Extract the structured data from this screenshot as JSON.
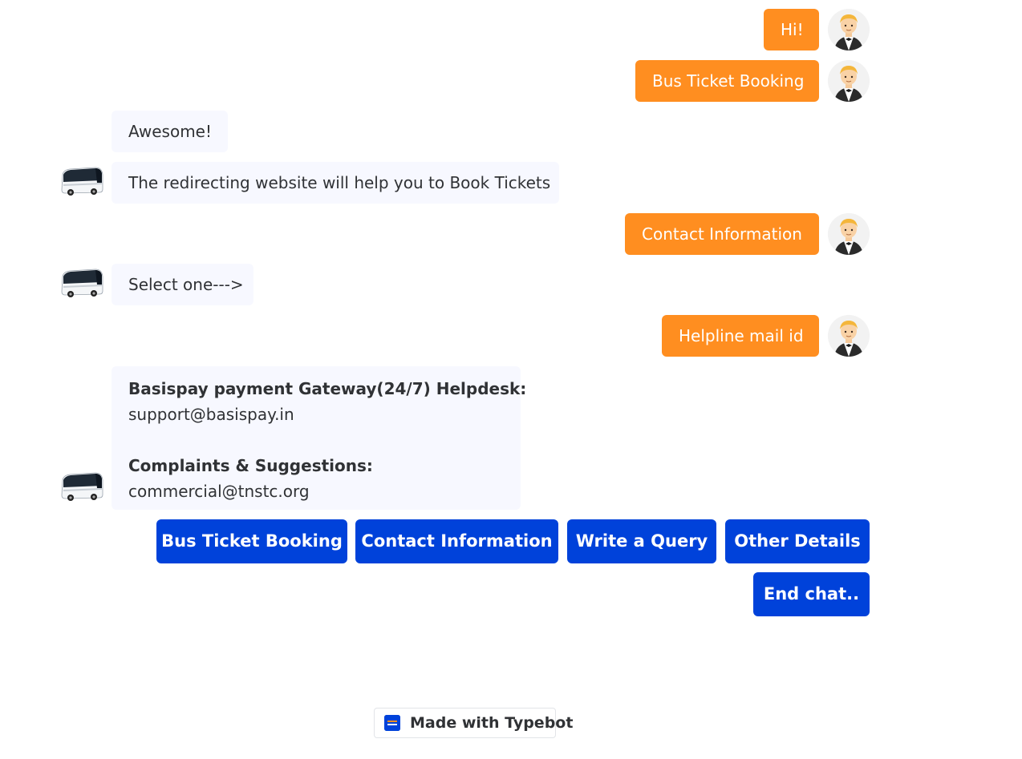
{
  "chat": {
    "user_messages": [
      "Hi!",
      "Bus Ticket Booking",
      "Contact Information",
      "Helpline mail id"
    ],
    "bot_messages": {
      "awesome": "Awesome!",
      "redirect": "The redirecting website will help you to Book Tickets",
      "select": "Select one--->",
      "helpdesk_heading": "Basispay payment Gateway(24/7) Helpdesk:",
      "helpdesk_email": "support@basispay.in",
      "complaints_heading": "Complaints & Suggestions:",
      "complaints_email": "commercial@tnstc.org"
    },
    "avatars": {
      "user_icon": "man-in-tuxedo-icon",
      "bot_icon": "bus-icon"
    }
  },
  "choices": [
    "Bus Ticket Booking",
    "Contact Information",
    "Write a Query",
    "Other Details",
    "End chat.."
  ],
  "branding": {
    "label": "Made with Typebot",
    "logo_icon": "typebot-logo-icon"
  },
  "colors": {
    "user_bubble": "#ff8e20",
    "bot_bubble": "#f7f8ff",
    "choice_button": "#0042da",
    "text": "#303235"
  }
}
